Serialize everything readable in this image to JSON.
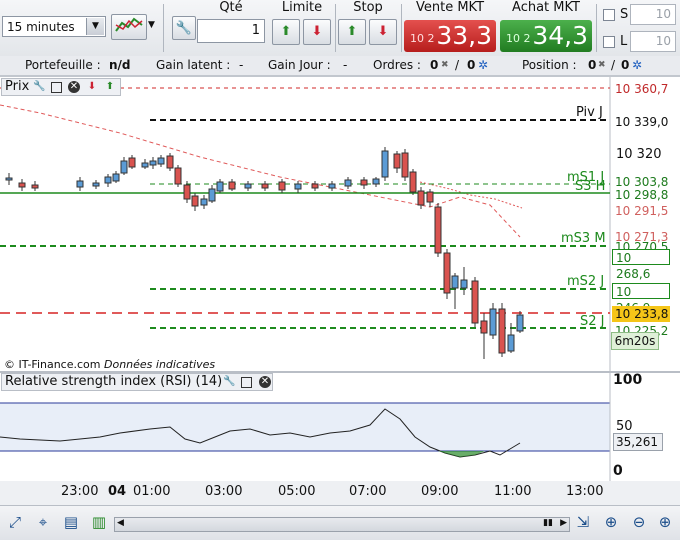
{
  "toolbar": {
    "timeframe": "15 minutes",
    "qty_label": "Qté",
    "qty_value": "1",
    "limit_label": "Limite",
    "stop_label": "Stop",
    "sell_label": "Vente MKT",
    "sell_prefix": "10 2",
    "sell_price": "33,3",
    "buy_label": "Achat MKT",
    "buy_prefix": "10 2",
    "buy_price": "34,3",
    "s_label": "S",
    "s_value": "10",
    "l_label": "L",
    "l_value": "10"
  },
  "status": {
    "portfolio_label": "Portefeuille :",
    "portfolio_value": "n/d",
    "latent_label": "Gain latent :",
    "latent_value": "-",
    "day_label": "Gain Jour :",
    "day_value": "-",
    "orders_label": "Ordres :",
    "orders_a": "0",
    "orders_b": "0",
    "position_label": "Position :",
    "position_a": "0",
    "position_b": "0"
  },
  "price_panel": {
    "title": "Prix",
    "copyright": "© IT-Finance.com",
    "disclaimer": "Données indicatives",
    "countdown": "6m20s",
    "axis_ticks": [
      "10 320"
    ],
    "tags": [
      {
        "text": "10 360,7",
        "color": "#c0292a",
        "bg": "#ffffff"
      },
      {
        "text": "10 339,0",
        "color": "#111111",
        "bg": "#ffffff"
      },
      {
        "text": "10 303,8",
        "color": "#1d7a1d",
        "bg": "#ffffff"
      },
      {
        "text": "10 298,8",
        "color": "#1d7a1d",
        "bg": "#ffffff"
      },
      {
        "text": "10 291,5",
        "color": "#d0605e",
        "bg": "#ffffff"
      },
      {
        "text": "10 271,3",
        "color": "#d0605e",
        "bg": "#ffffff"
      },
      {
        "text": "10 270,5",
        "color": "#1d7a1d",
        "bg": "#ffffff"
      },
      {
        "text": "10 268,6",
        "color": "#1d7a1d",
        "bg": "#ffffff"
      },
      {
        "text": "10 246,9",
        "color": "#1d7a1d",
        "bg": "#ffffff"
      },
      {
        "text": "10 233,8",
        "color": "#111111",
        "bg": "#f5c518"
      },
      {
        "text": "10 225,2",
        "color": "#1d7a1d",
        "bg": "#ffffff"
      }
    ],
    "levels": {
      "piv": "Piv J",
      "ms1": "mS1 J",
      "s3h": "S3 H",
      "ms3": "mS3 M",
      "ms2": "mS2 J",
      "s2": "S2 J"
    }
  },
  "rsi_panel": {
    "title": "Relative strength index (RSI) (14)",
    "axis_100": "100",
    "axis_50": "50",
    "axis_0": "0",
    "value": "35,261"
  },
  "time_axis": [
    "23:00",
    "04",
    "01:00",
    "03:00",
    "05:00",
    "07:00",
    "09:00",
    "11:00",
    "13:00"
  ],
  "colors": {
    "bull": "#5b9bd5",
    "bear": "#d9534f",
    "pivot_green": "#1d8a1d",
    "ma_red": "#e05a5a"
  }
}
